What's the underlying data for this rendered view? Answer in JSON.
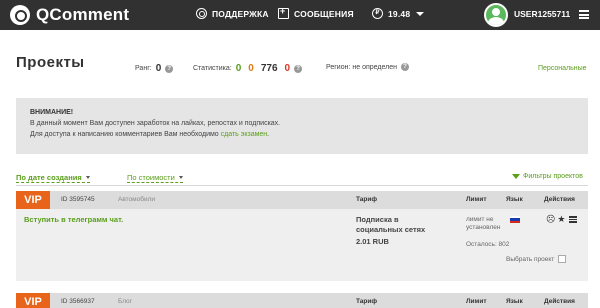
{
  "brand": {
    "name": "QComment"
  },
  "topnav": {
    "support_label": "ПОДДЕРЖКА",
    "messages_label": "СООБЩЕНИЯ",
    "balance_icon_glyph": "₽",
    "balance": "19.48",
    "username": "USER1255711"
  },
  "page": {
    "title": "Проекты",
    "rank_label": "Ранг:",
    "rank_value": "0",
    "stats_label": "Статистика:",
    "stats_values": [
      "0",
      "0",
      "776",
      "0"
    ],
    "region_label": "Регион: не определен",
    "personal_link": "Персональные",
    "help_glyph": "?"
  },
  "attention": {
    "title": "ВНИМАНИЕ!",
    "line1": "В данный момент Вам доступен заработок на лайках, репостах и подписках.",
    "line2_prefix": "Для доступа к написанию комментариев Вам необходимо",
    "line2_link": "сдать экзамен",
    "line2_suffix": "."
  },
  "sorting": {
    "by_date": "По дате создания",
    "by_price": "По стоимости",
    "filters": "Фильтры проектов"
  },
  "columns": {
    "tariff": "Тариф",
    "limit": "Лимит",
    "language": "Язык",
    "actions": "Действия"
  },
  "projects": [
    {
      "badge": "VIP",
      "id": "ID 3595745",
      "category": "Автомобили",
      "title": "Вступить в телеграмм чат.",
      "tariff_name": "Подписка в социальных сетях",
      "price": "2.01 RUB",
      "limit": "лимит не установлен",
      "remaining": "Осталось: 802",
      "select_label": "Выбрать проект",
      "language_flag": "ru"
    },
    {
      "badge": "VIP",
      "id": "ID 3566937",
      "category": "Блог"
    }
  ],
  "colors": {
    "accent_green": "#5a9e1b",
    "vip_orange": "#e8641b",
    "topbar": "#313131"
  }
}
